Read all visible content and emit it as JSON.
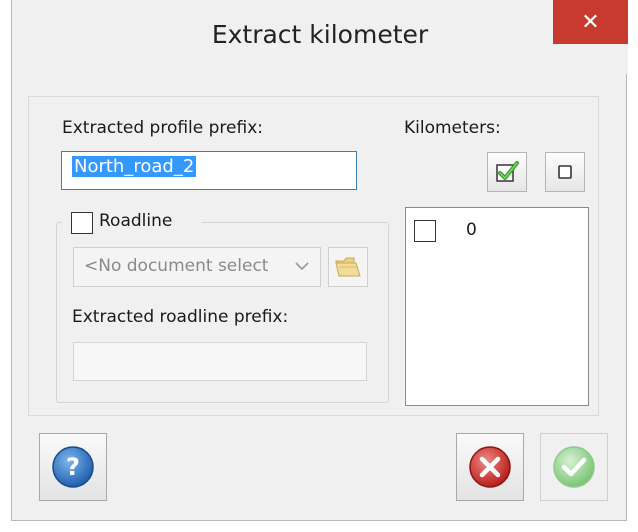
{
  "window": {
    "title": "Extract kilometer",
    "close_glyph": "✕"
  },
  "profile": {
    "prefix_label": "Extracted profile prefix:",
    "prefix_value": "North_road_2"
  },
  "roadline": {
    "checkbox_label": "Roadline",
    "checked": false,
    "document_select_value": "<No document select",
    "roadline_prefix_label": "Extracted roadline prefix:",
    "roadline_prefix_value": ""
  },
  "kilometers": {
    "label": "Kilometers:",
    "items": [
      {
        "label": "0",
        "checked": false
      }
    ]
  },
  "icons": {
    "select_all": "checkmark-icon",
    "select_none": "square-icon",
    "folder": "folder-icon",
    "help": "question-icon",
    "cancel": "x-circle-icon",
    "ok": "check-circle-icon"
  },
  "colors": {
    "close_button": "#c8392e",
    "input_focus_border": "#3c7fb1",
    "selection": "#3399ff",
    "help_blue": "#2f74c0",
    "cancel_red": "#d2302b",
    "ok_green_disabled": "#8fd08a"
  }
}
